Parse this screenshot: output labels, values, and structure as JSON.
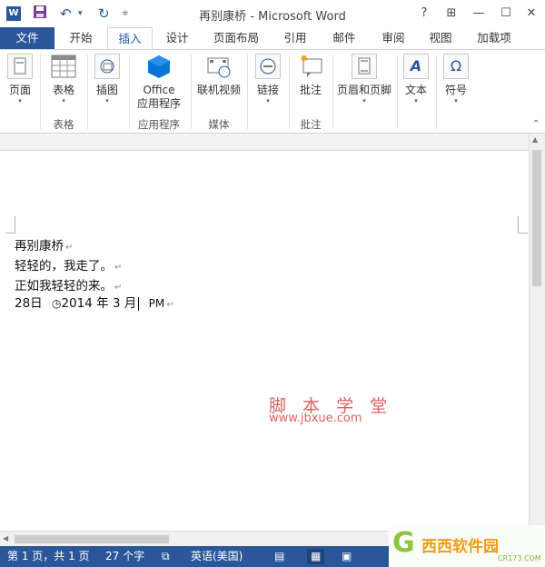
{
  "window": {
    "title": "再别康桥 - Microsoft Word",
    "app_logo": "W"
  },
  "qat": {
    "save_icon": "save-icon",
    "undo_icon": "undo-icon",
    "redo_icon": "redo-icon"
  },
  "window_controls": {
    "help": "?",
    "restore_ribbon": "⊞",
    "minimize": "—",
    "maximize": "☐",
    "close": "✕"
  },
  "tabs": [
    "文件",
    "开始",
    "插入",
    "设计",
    "页面布局",
    "引用",
    "邮件",
    "审阅",
    "视图",
    "加载项"
  ],
  "active_tab": "插入",
  "ribbon": {
    "buttons": {
      "pages": "页面",
      "table": "表格",
      "illustrations": "插图",
      "office_apps_1": "Office",
      "office_apps_2": "应用程序",
      "online_video": "联机视频",
      "links": "链接",
      "comment": "批注",
      "header_footer": "页眉和页脚",
      "text": "文本",
      "symbols": "符号"
    },
    "groups": {
      "tables": "表格",
      "apps": "应用程序",
      "media": "媒体",
      "comments": "批注"
    }
  },
  "document": {
    "lines": [
      "再别康桥",
      "轻轻的，我走了。",
      "正如我轻轻的来。"
    ],
    "date_line": {
      "day": "28日",
      "clock": "◷",
      "year_month": "2014 年 3 月",
      "ampm": "PM"
    },
    "paragraph_mark": "↵"
  },
  "watermark": {
    "name": "脚 本 学 堂",
    "url": "www.jbxue.com"
  },
  "statusbar": {
    "page": "第 1 页，共 1 页",
    "words": "27 个字",
    "language": "英语(美国)"
  },
  "badge": {
    "logo": "G",
    "text": "西西软件园",
    "url": "CR173.COM"
  },
  "colors": {
    "accent": "#2b579a",
    "watermark": "#e06060"
  }
}
